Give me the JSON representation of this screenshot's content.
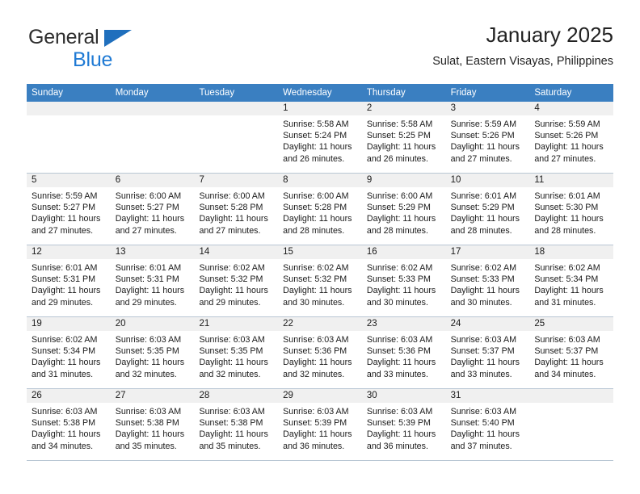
{
  "brand": {
    "line1": "General",
    "line2": "Blue",
    "accent_blue": "#1f7ad4",
    "triangle_blue": "#1f6fbd"
  },
  "header": {
    "title": "January 2025",
    "subtitle": "Sulat, Eastern Visayas, Philippines"
  },
  "colors": {
    "header_row_bg": "#3a7fc1",
    "day_band_bg": "#f0f0f0",
    "grid_line": "#b9c7d4"
  },
  "calendar": {
    "weekdays": [
      "Sunday",
      "Monday",
      "Tuesday",
      "Wednesday",
      "Thursday",
      "Friday",
      "Saturday"
    ],
    "weeks": [
      [
        {
          "day": "",
          "lines": []
        },
        {
          "day": "",
          "lines": []
        },
        {
          "day": "",
          "lines": []
        },
        {
          "day": "1",
          "lines": [
            "Sunrise: 5:58 AM",
            "Sunset: 5:24 PM",
            "Daylight: 11 hours",
            "and 26 minutes."
          ]
        },
        {
          "day": "2",
          "lines": [
            "Sunrise: 5:58 AM",
            "Sunset: 5:25 PM",
            "Daylight: 11 hours",
            "and 26 minutes."
          ]
        },
        {
          "day": "3",
          "lines": [
            "Sunrise: 5:59 AM",
            "Sunset: 5:26 PM",
            "Daylight: 11 hours",
            "and 27 minutes."
          ]
        },
        {
          "day": "4",
          "lines": [
            "Sunrise: 5:59 AM",
            "Sunset: 5:26 PM",
            "Daylight: 11 hours",
            "and 27 minutes."
          ]
        }
      ],
      [
        {
          "day": "5",
          "lines": [
            "Sunrise: 5:59 AM",
            "Sunset: 5:27 PM",
            "Daylight: 11 hours",
            "and 27 minutes."
          ]
        },
        {
          "day": "6",
          "lines": [
            "Sunrise: 6:00 AM",
            "Sunset: 5:27 PM",
            "Daylight: 11 hours",
            "and 27 minutes."
          ]
        },
        {
          "day": "7",
          "lines": [
            "Sunrise: 6:00 AM",
            "Sunset: 5:28 PM",
            "Daylight: 11 hours",
            "and 27 minutes."
          ]
        },
        {
          "day": "8",
          "lines": [
            "Sunrise: 6:00 AM",
            "Sunset: 5:28 PM",
            "Daylight: 11 hours",
            "and 28 minutes."
          ]
        },
        {
          "day": "9",
          "lines": [
            "Sunrise: 6:00 AM",
            "Sunset: 5:29 PM",
            "Daylight: 11 hours",
            "and 28 minutes."
          ]
        },
        {
          "day": "10",
          "lines": [
            "Sunrise: 6:01 AM",
            "Sunset: 5:29 PM",
            "Daylight: 11 hours",
            "and 28 minutes."
          ]
        },
        {
          "day": "11",
          "lines": [
            "Sunrise: 6:01 AM",
            "Sunset: 5:30 PM",
            "Daylight: 11 hours",
            "and 28 minutes."
          ]
        }
      ],
      [
        {
          "day": "12",
          "lines": [
            "Sunrise: 6:01 AM",
            "Sunset: 5:31 PM",
            "Daylight: 11 hours",
            "and 29 minutes."
          ]
        },
        {
          "day": "13",
          "lines": [
            "Sunrise: 6:01 AM",
            "Sunset: 5:31 PM",
            "Daylight: 11 hours",
            "and 29 minutes."
          ]
        },
        {
          "day": "14",
          "lines": [
            "Sunrise: 6:02 AM",
            "Sunset: 5:32 PM",
            "Daylight: 11 hours",
            "and 29 minutes."
          ]
        },
        {
          "day": "15",
          "lines": [
            "Sunrise: 6:02 AM",
            "Sunset: 5:32 PM",
            "Daylight: 11 hours",
            "and 30 minutes."
          ]
        },
        {
          "day": "16",
          "lines": [
            "Sunrise: 6:02 AM",
            "Sunset: 5:33 PM",
            "Daylight: 11 hours",
            "and 30 minutes."
          ]
        },
        {
          "day": "17",
          "lines": [
            "Sunrise: 6:02 AM",
            "Sunset: 5:33 PM",
            "Daylight: 11 hours",
            "and 30 minutes."
          ]
        },
        {
          "day": "18",
          "lines": [
            "Sunrise: 6:02 AM",
            "Sunset: 5:34 PM",
            "Daylight: 11 hours",
            "and 31 minutes."
          ]
        }
      ],
      [
        {
          "day": "19",
          "lines": [
            "Sunrise: 6:02 AM",
            "Sunset: 5:34 PM",
            "Daylight: 11 hours",
            "and 31 minutes."
          ]
        },
        {
          "day": "20",
          "lines": [
            "Sunrise: 6:03 AM",
            "Sunset: 5:35 PM",
            "Daylight: 11 hours",
            "and 32 minutes."
          ]
        },
        {
          "day": "21",
          "lines": [
            "Sunrise: 6:03 AM",
            "Sunset: 5:35 PM",
            "Daylight: 11 hours",
            "and 32 minutes."
          ]
        },
        {
          "day": "22",
          "lines": [
            "Sunrise: 6:03 AM",
            "Sunset: 5:36 PM",
            "Daylight: 11 hours",
            "and 32 minutes."
          ]
        },
        {
          "day": "23",
          "lines": [
            "Sunrise: 6:03 AM",
            "Sunset: 5:36 PM",
            "Daylight: 11 hours",
            "and 33 minutes."
          ]
        },
        {
          "day": "24",
          "lines": [
            "Sunrise: 6:03 AM",
            "Sunset: 5:37 PM",
            "Daylight: 11 hours",
            "and 33 minutes."
          ]
        },
        {
          "day": "25",
          "lines": [
            "Sunrise: 6:03 AM",
            "Sunset: 5:37 PM",
            "Daylight: 11 hours",
            "and 34 minutes."
          ]
        }
      ],
      [
        {
          "day": "26",
          "lines": [
            "Sunrise: 6:03 AM",
            "Sunset: 5:38 PM",
            "Daylight: 11 hours",
            "and 34 minutes."
          ]
        },
        {
          "day": "27",
          "lines": [
            "Sunrise: 6:03 AM",
            "Sunset: 5:38 PM",
            "Daylight: 11 hours",
            "and 35 minutes."
          ]
        },
        {
          "day": "28",
          "lines": [
            "Sunrise: 6:03 AM",
            "Sunset: 5:38 PM",
            "Daylight: 11 hours",
            "and 35 minutes."
          ]
        },
        {
          "day": "29",
          "lines": [
            "Sunrise: 6:03 AM",
            "Sunset: 5:39 PM",
            "Daylight: 11 hours",
            "and 36 minutes."
          ]
        },
        {
          "day": "30",
          "lines": [
            "Sunrise: 6:03 AM",
            "Sunset: 5:39 PM",
            "Daylight: 11 hours",
            "and 36 minutes."
          ]
        },
        {
          "day": "31",
          "lines": [
            "Sunrise: 6:03 AM",
            "Sunset: 5:40 PM",
            "Daylight: 11 hours",
            "and 37 minutes."
          ]
        },
        {
          "day": "",
          "lines": []
        }
      ]
    ]
  }
}
